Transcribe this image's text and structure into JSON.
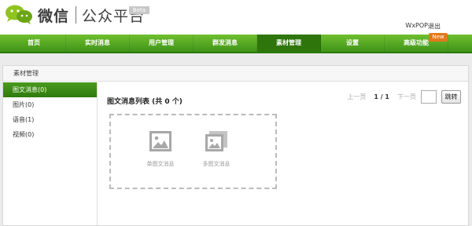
{
  "header": {
    "logo_main": "微信",
    "logo_sub": "公众平台",
    "beta": "Beta",
    "user": "WxPOP",
    "logout": "退出"
  },
  "nav": {
    "items": [
      "首页",
      "实时消息",
      "用户管理",
      "群发消息",
      "素材管理",
      "设置",
      "高级功能"
    ],
    "active_index": 4,
    "new_badge": "New"
  },
  "panel": {
    "title": "素材管理"
  },
  "sidebar": {
    "items": [
      "图文消息(0)",
      "图片(0)",
      "语音(1)",
      "视频(0)"
    ],
    "active_index": 0
  },
  "main": {
    "list_title": "图文消息列表 (共 0 个)",
    "pager": {
      "prev": "上一页",
      "current": "1 / 1",
      "next": "下一页",
      "go": "跳转"
    },
    "create_single": "单图文消息",
    "create_multi": "多图文消息"
  },
  "colors": {
    "nav_green": "#4f9f1f",
    "nav_active": "#2e760c",
    "badge_orange": "#e4781c"
  }
}
